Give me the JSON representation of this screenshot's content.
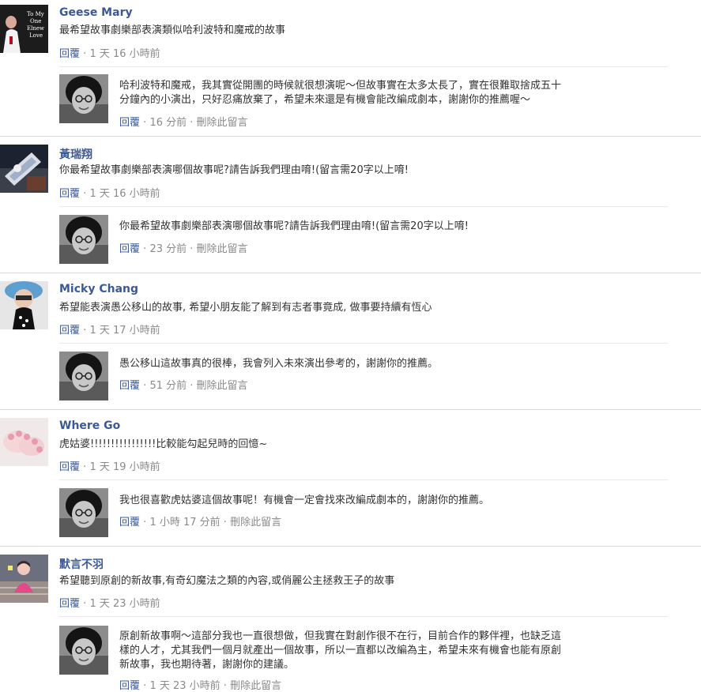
{
  "labels": {
    "reply": "回覆",
    "delete": "刪除此留言",
    "dot": "·"
  },
  "threads": [
    {
      "author": "Geese Mary",
      "avatar_caption": [
        "To My",
        "One",
        "Elnew",
        "Love"
      ],
      "text": [
        "最希望故事劇樂部表演類似哈利波特和魔戒的故事"
      ],
      "time": "1 天 16 小時前",
      "reply": {
        "text": [
          "哈利波特和魔戒，我其實從開團的時候就很想演呢～但故事實在太多太長了，實在很難取捨成五十",
          "分鐘內的小演出，只好忍痛放棄了，希望未來還是有機會能改編成劇本，謝謝你的推薦喔～"
        ],
        "time": "16 分前"
      }
    },
    {
      "author": "黃瑞翔",
      "text": [
        "你最希望故事劇樂部表演哪個故事呢?請告訴我們理由唷!(留言需20字以上唷!"
      ],
      "time": "1 天 16 小時前",
      "reply": {
        "text": [
          "你最希望故事劇樂部表演哪個故事呢?請告訴我們理由唷!(留言需20字以上唷!"
        ],
        "time": "23 分前"
      }
    },
    {
      "author": "Micky Chang",
      "text": [
        "希望能表演愚公移山的故事, 希望小朋友能了解到有志者事竟成, 做事要持續有恆心"
      ],
      "time": "1 天 17 小時前",
      "reply": {
        "text": [
          "愚公移山這故事真的很棒，我會列入未來演出參考的，謝謝你的推薦。"
        ],
        "time": "51 分前"
      }
    },
    {
      "author": "Where Go",
      "text": [
        "虎姑婆!!!!!!!!!!!!!!!!比較能勾起兒時的回憶~"
      ],
      "time": "1 天 19 小時前",
      "reply": {
        "text": [
          "我也很喜歡虎姑婆這個故事呢！有機會一定會找來改編成劇本的，謝謝你的推薦。"
        ],
        "time": "1 小時 17 分前"
      }
    },
    {
      "author": "默言不羽",
      "text": [
        "希望聽到原創的新故事,有奇幻魔法之類的內容,或俏麗公主拯救王子的故事"
      ],
      "time": "1 天 23 小時前",
      "reply": {
        "text": [
          "原創新故事啊～這部分我也一直很想做，但我實在對創作很不在行，目前合作的夥伴裡，也缺乏這",
          "樣的人才，尤其我們一個月就產出一個故事，所以一直都以改編為主，希望未來有機會也能有原創",
          "新故事，我也期待著，謝謝你的建議。"
        ],
        "time": "1 天 23 小時前"
      }
    }
  ]
}
